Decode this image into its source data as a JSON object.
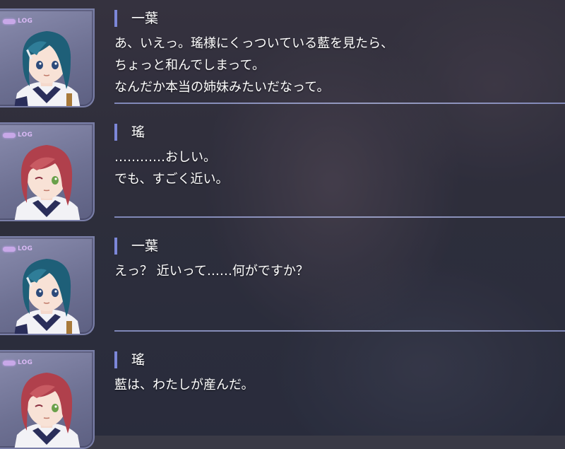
{
  "log_label": "LOG",
  "entries": [
    {
      "speaker": "一葉",
      "character": "blue-haired-girl",
      "lines": [
        "あ、いえっ。瑤様にくっついている藍を見たら、",
        "ちょっと和んでしまって。",
        "なんだか本当の姉妹みたいだなって。"
      ]
    },
    {
      "speaker": "瑤",
      "character": "red-haired-girl",
      "lines": [
        "…………おしい。",
        "でも、すごく近い。"
      ]
    },
    {
      "speaker": "一葉",
      "character": "blue-haired-girl",
      "lines": [
        "えっ？ 近いって……何がですか？"
      ]
    },
    {
      "speaker": "瑤",
      "character": "red-haired-girl",
      "lines": [
        "藍は、わたしが産んだ。"
      ]
    }
  ],
  "colors": {
    "accent_bar": "#7c87d8",
    "divider": "#9aa4e0",
    "log_tag": "#d8b8f4",
    "blue_hair": "#1e5f78",
    "red_hair": "#b0404c"
  }
}
